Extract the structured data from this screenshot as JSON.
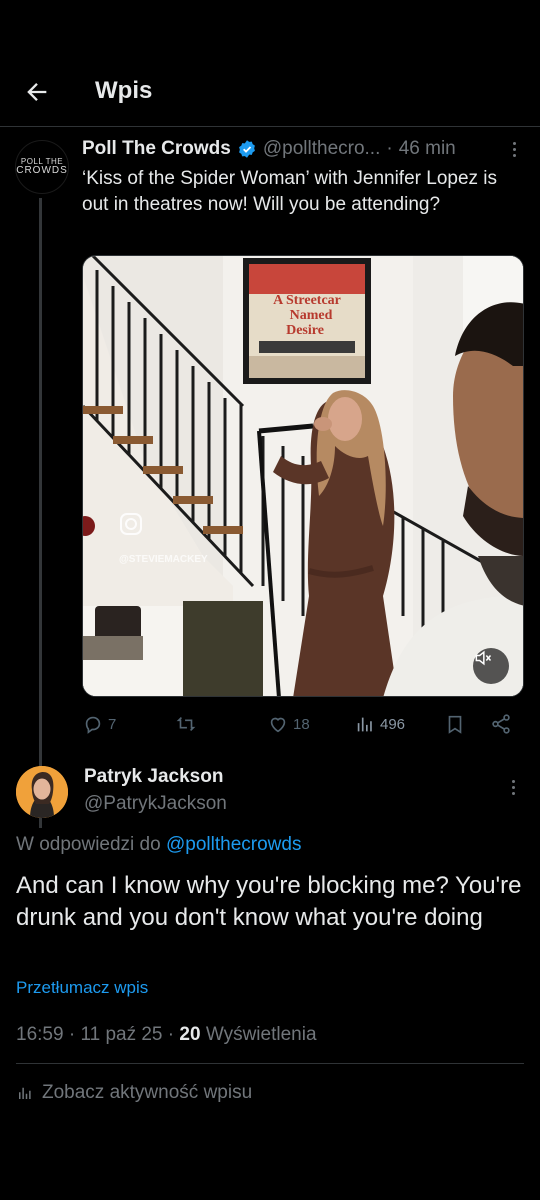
{
  "header": {
    "title": "Wpis"
  },
  "parent_post": {
    "avatar_line1": "POLL THE",
    "avatar_line2": "CROWDS",
    "author_name": "Poll The Crowds",
    "author_handle": "@pollthecro...",
    "separator": "·",
    "time_ago": "46 min",
    "text": "‘Kiss of the Spider Woman’ with Jennifer Lopez is out in theatres now! Will you be attending?",
    "media": {
      "poster_line1": "A Streetcar",
      "poster_line2": "Named",
      "poster_line3": "Desire",
      "watermark": "@STEVIEMACKEY"
    },
    "actions": {
      "replies": "7",
      "retweets": "",
      "likes": "18",
      "views": "496"
    }
  },
  "reply_post": {
    "author_name": "Patryk Jackson",
    "author_handle": "@PatrykJackson",
    "replying_prefix": "W odpowiedzi do",
    "replying_to": "@pollthecrowds",
    "text": "And can I know why you're blocking me? You're drunk and you don't know what you're doing",
    "translate_label": "Przetłumacz wpis",
    "time": "16:59",
    "separator": "·",
    "date": "11 paź 25",
    "views_count": "20",
    "views_label": "Wyświetlenia",
    "activity_label": "Zobacz aktywność wpisu"
  },
  "colors": {
    "background": "#000000",
    "text": "#e7e9ea",
    "secondary": "#71767b",
    "accent": "#1d9bf0",
    "divider": "#2f3336"
  },
  "icons": [
    "back-arrow-icon",
    "verified-badge-icon",
    "more-icon",
    "reply-icon",
    "retweet-icon",
    "like-icon",
    "views-icon",
    "bookmark-icon",
    "share-icon",
    "mute-icon"
  ]
}
